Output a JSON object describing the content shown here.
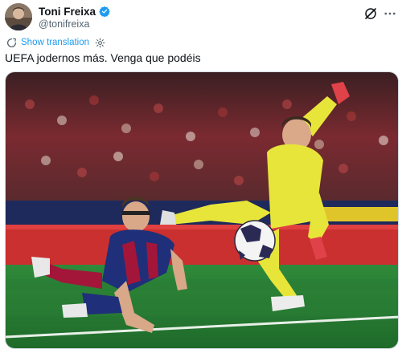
{
  "author": {
    "display_name": "Toni Freixa",
    "handle": "@tonifreixa",
    "verified": true,
    "avatar_icon": "person-avatar"
  },
  "translation": {
    "label": "Show translation",
    "icon": "translate-icon",
    "settings_icon": "gear-icon"
  },
  "tweet": {
    "text": "UEFA jodernos más. Venga que podéis"
  },
  "actions": {
    "grok_icon": "grok-icon",
    "more_icon": "more-options-icon"
  },
  "media": {
    "kind": "photo",
    "description_icon": "football-match-photo"
  },
  "colors": {
    "link": "#1d9bf0",
    "verified": "#1d9bf0",
    "text_primary": "#0f1419",
    "text_secondary": "#536471"
  }
}
